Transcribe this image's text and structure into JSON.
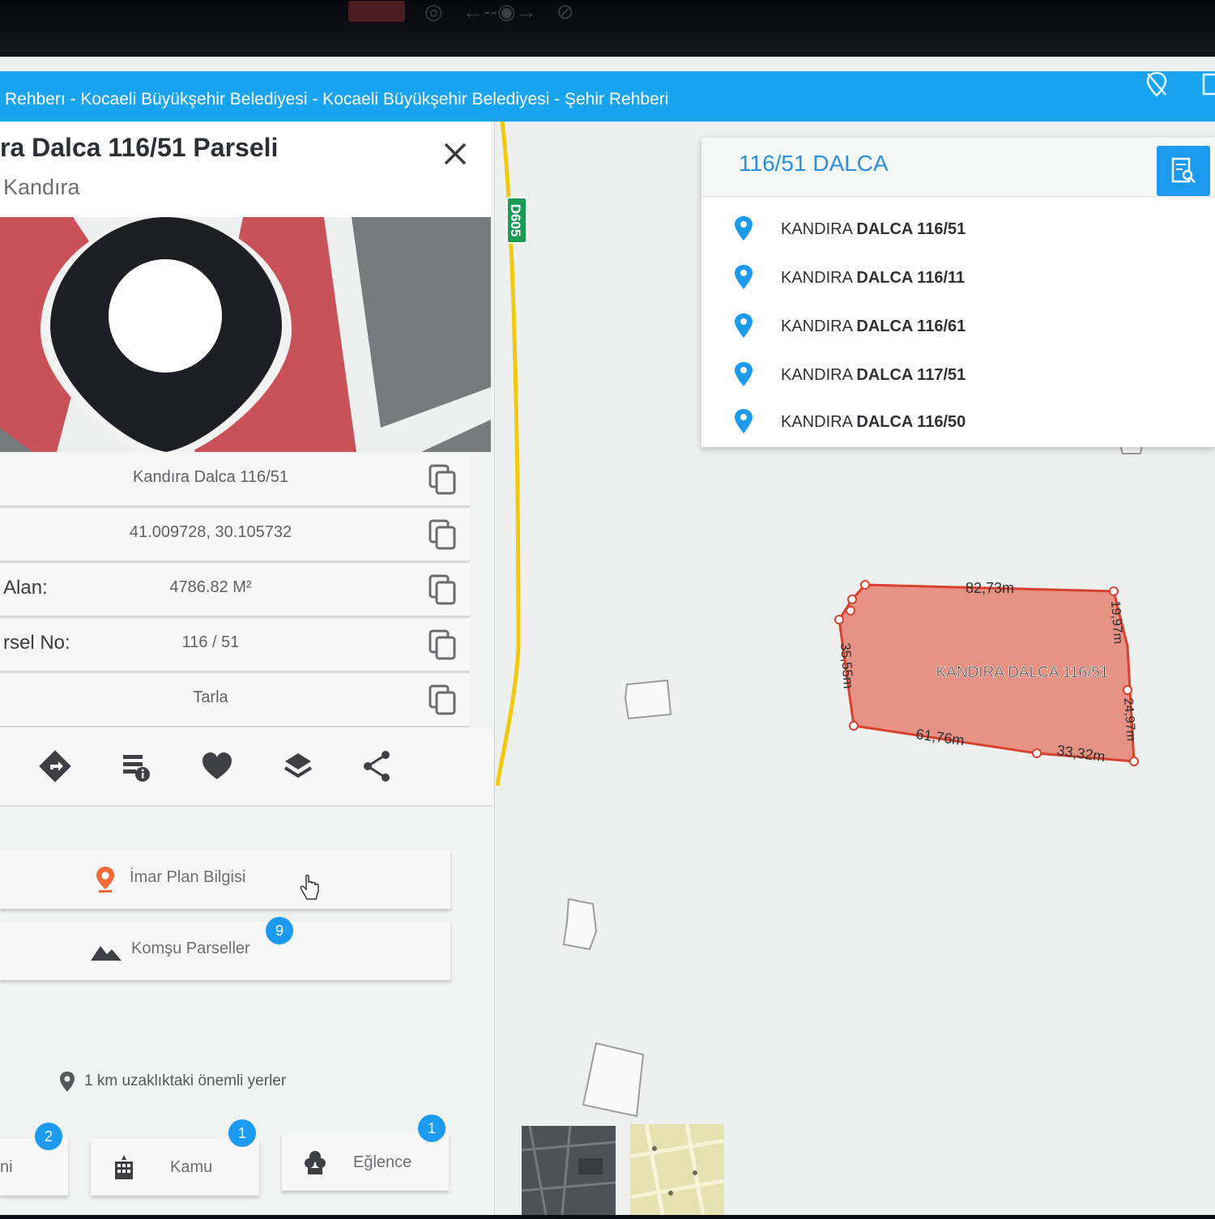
{
  "window": {
    "title": "Rehberı - Kocaeli Büyükşehir Belediyesi - Kocaeli Büyükşehir Belediyesi - Şehir Rehberi"
  },
  "panel": {
    "title": "ra Dalca 116/51 Parseli",
    "subtitle": "Kandıra",
    "rows": [
      {
        "label": "",
        "value": "Kandıra Dalca 116/51"
      },
      {
        "label": "",
        "value": "41.009728, 30.105732"
      },
      {
        "label": "Alan:",
        "value": "4786.82 M²"
      },
      {
        "label": "rsel No:",
        "value": "116 / 51"
      },
      {
        "label": "",
        "value": "Tarla"
      }
    ],
    "buttons": {
      "imar": "İmar Plan Bilgisi",
      "komsu": "Komşu Parseller",
      "komsu_count": "9"
    },
    "nearby": {
      "label": "1 km uzaklıktaki önemli yerler",
      "categories": [
        {
          "label": "ni",
          "count": "2"
        },
        {
          "label": "Kamu",
          "count": "1"
        },
        {
          "label": "Eğlence",
          "count": "1"
        }
      ]
    }
  },
  "search": {
    "query": "116/51 DALCA",
    "results": [
      {
        "prefix": "KANDIRA",
        "bold": "DALCA 116/51"
      },
      {
        "prefix": "KANDIRA",
        "bold": "DALCA 116/11"
      },
      {
        "prefix": "KANDIRA",
        "bold": "DALCA 116/61"
      },
      {
        "prefix": "KANDIRA",
        "bold": "DALCA 117/51"
      },
      {
        "prefix": "KANDIRA",
        "bold": "DALCA 116/50"
      }
    ]
  },
  "map": {
    "road_label": "D605",
    "parcel_label": "KANDIRA DALCA 116/51",
    "dimensions": [
      "82,73m",
      "19,97m",
      "24,97m",
      "35,55m",
      "61,76m",
      "33,32m"
    ]
  },
  "colors": {
    "accent": "#1b9af0",
    "parcel_fill": "#e58a7c",
    "parcel_stroke": "#d9412e",
    "road": "#f2c90f"
  }
}
